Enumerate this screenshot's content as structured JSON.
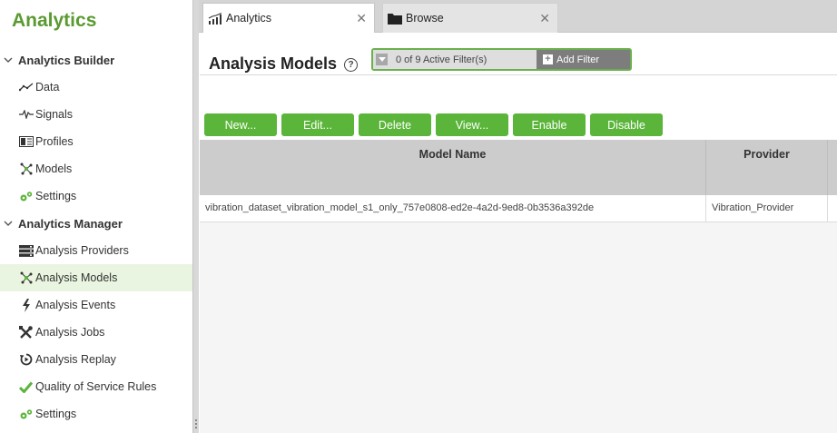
{
  "sidebar": {
    "title": "Analytics",
    "sections": [
      {
        "label": "Analytics Builder",
        "items": [
          {
            "label": "Data",
            "icon": "line-chart-icon"
          },
          {
            "label": "Signals",
            "icon": "waveform-icon"
          },
          {
            "label": "Profiles",
            "icon": "profile-card-icon"
          },
          {
            "label": "Models",
            "icon": "network-node-icon"
          },
          {
            "label": "Settings",
            "icon": "gears-icon"
          }
        ]
      },
      {
        "label": "Analytics Manager",
        "items": [
          {
            "label": "Analysis Providers",
            "icon": "server-icon"
          },
          {
            "label": "Analysis Models",
            "icon": "network-node-icon",
            "active": true
          },
          {
            "label": "Analysis Events",
            "icon": "lightning-icon"
          },
          {
            "label": "Analysis Jobs",
            "icon": "tools-icon"
          },
          {
            "label": "Analysis Replay",
            "icon": "replay-icon"
          },
          {
            "label": "Quality of Service Rules",
            "icon": "checkmark-icon"
          },
          {
            "label": "Settings",
            "icon": "gears-icon"
          }
        ]
      }
    ]
  },
  "tabs": [
    {
      "label": "Analytics",
      "icon": "bar-chart-icon",
      "active": true
    },
    {
      "label": "Browse",
      "icon": "folder-icon",
      "active": false
    }
  ],
  "main": {
    "title": "Analysis Models",
    "filter": {
      "text": "0 of 9 Active Filter(s)",
      "add_label": "Add Filter"
    },
    "buttons": [
      "New...",
      "Edit...",
      "Delete",
      "View...",
      "Enable",
      "Disable"
    ],
    "table": {
      "columns": [
        "Model Name",
        "Provider"
      ],
      "rows": [
        [
          "vibration_dataset_vibration_model_s1_only_757e0808-ed2e-4a2d-9ed8-0b3536a392de",
          "Vibration_Provider"
        ]
      ]
    }
  },
  "colors": {
    "accent": "#5bb53a",
    "title_green": "#5a9a30",
    "active_bg": "#e9f5e0"
  }
}
